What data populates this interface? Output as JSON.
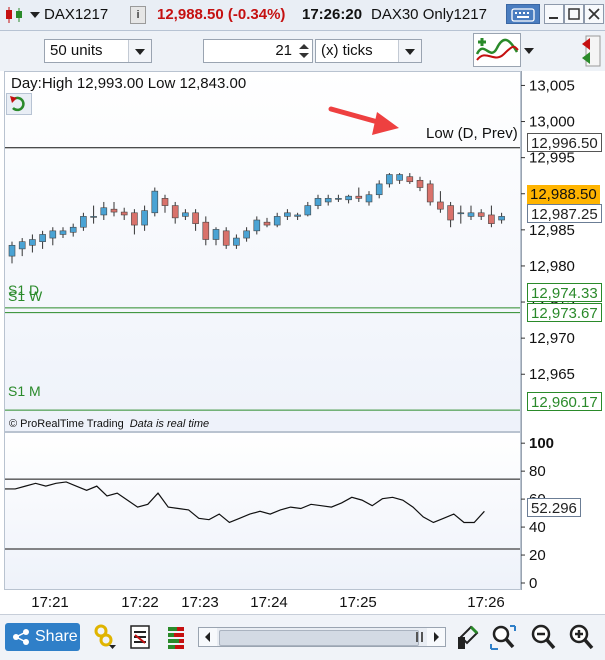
{
  "titlebar": {
    "symbol": "DAX1217",
    "price_change": "12,988.50 (-0.34%)",
    "time": "17:26:20",
    "instrument": "DAX30 Only1217",
    "info_icon_text": "i"
  },
  "toolbar": {
    "units_select": "50 units",
    "ticks_value": "21",
    "ticks_select": "(x) ticks"
  },
  "chart": {
    "header": "Day:High 12,993.00 Low 12,843.00",
    "watermark_source": "© ProRealTime Trading",
    "watermark_status": "Data is real time",
    "annotation": "Low (D, Prev)",
    "levels": [
      "S1 D",
      "S1 W",
      "S1 M"
    ]
  },
  "price_axis": {
    "ticks": [
      "13,005",
      "13,000",
      "12,995",
      "12,990",
      "12,985",
      "12,980",
      "12,975",
      "12,970",
      "12,965"
    ],
    "tags": [
      "12,996.50",
      "12,988.50",
      "12,987.25",
      "12,974.33",
      "12,973.67",
      "12,960.17"
    ]
  },
  "osc_axis": {
    "ticks": [
      "100",
      "80",
      "60",
      "40",
      "20",
      "0"
    ],
    "value_tag": "52.296"
  },
  "time_axis": [
    "17:21",
    "17:22",
    "17:23",
    "17:24",
    "17:25",
    "17:26"
  ],
  "bottombar": {
    "share_label": "Share"
  },
  "colors": {
    "price_down": "#c51010",
    "up_candle": "#4aa3d4",
    "down_candle": "#d9726b",
    "support_green": "#2a8a2a",
    "current_price_bg": "#ffb400",
    "accent": "#2f7fc8"
  },
  "chart_data": {
    "type": "candlestick",
    "ylabel": "",
    "xlabel": "",
    "ylim": [
      12957,
      13007
    ],
    "ohlc": [
      [
        12981.5,
        12983.5,
        12980.5,
        12983.0
      ],
      [
        12982.5,
        12984.0,
        12981.5,
        12983.5
      ],
      [
        12983.0,
        12984.5,
        12982.0,
        12983.8
      ],
      [
        12983.5,
        12985.0,
        12982.5,
        12984.5
      ],
      [
        12984.0,
        12985.5,
        12983.0,
        12985.0
      ],
      [
        12984.5,
        12985.5,
        12984.0,
        12985.0
      ],
      [
        12984.8,
        12986.0,
        12984.2,
        12985.5
      ],
      [
        12985.5,
        12987.5,
        12985.0,
        12987.0
      ],
      [
        12987.0,
        12988.5,
        12986.0,
        12987.0
      ],
      [
        12987.2,
        12989.0,
        12986.5,
        12988.2
      ],
      [
        12988.0,
        12989.0,
        12987.0,
        12987.6
      ],
      [
        12987.6,
        12988.2,
        12986.5,
        12987.2
      ],
      [
        12987.5,
        12988.0,
        12984.5,
        12985.8
      ],
      [
        12985.8,
        12988.5,
        12985.0,
        12987.8
      ],
      [
        12987.5,
        12991.0,
        12987.0,
        12990.5
      ],
      [
        12989.5,
        12990.0,
        12987.5,
        12988.5
      ],
      [
        12988.5,
        12989.0,
        12986.0,
        12986.8
      ],
      [
        12987.0,
        12988.0,
        12986.5,
        12987.5
      ],
      [
        12987.5,
        12988.0,
        12985.0,
        12986.0
      ],
      [
        12986.2,
        12987.0,
        12983.0,
        12983.8
      ],
      [
        12983.8,
        12985.5,
        12983.0,
        12985.2
      ],
      [
        12985.0,
        12985.5,
        12982.5,
        12983.0
      ],
      [
        12983.0,
        12984.5,
        12982.5,
        12984.0
      ],
      [
        12984.0,
        12985.5,
        12983.5,
        12985.0
      ],
      [
        12985.0,
        12987.0,
        12984.5,
        12986.5
      ],
      [
        12986.2,
        12986.8,
        12985.5,
        12985.8
      ],
      [
        12985.8,
        12987.5,
        12985.5,
        12987.0
      ],
      [
        12987.0,
        12988.0,
        12986.5,
        12987.5
      ],
      [
        12987.0,
        12987.5,
        12986.5,
        12987.2
      ],
      [
        12987.2,
        12989.0,
        12987.0,
        12988.5
      ],
      [
        12988.5,
        12990.0,
        12988.0,
        12989.5
      ],
      [
        12989.0,
        12990.0,
        12988.5,
        12989.5
      ],
      [
        12989.5,
        12990.0,
        12989.0,
        12989.5
      ],
      [
        12989.3,
        12990.0,
        12988.8,
        12989.8
      ],
      [
        12989.8,
        12991.0,
        12989.0,
        12989.5
      ],
      [
        12989.0,
        12990.5,
        12988.5,
        12990.0
      ],
      [
        12990.0,
        12992.0,
        12989.5,
        12991.5
      ],
      [
        12991.5,
        12993.0,
        12991.0,
        12992.8
      ],
      [
        12992.0,
        12993.0,
        12991.5,
        12992.8
      ],
      [
        12992.5,
        12993.0,
        12991.5,
        12991.8
      ],
      [
        12992.0,
        12992.5,
        12990.5,
        12991.0
      ],
      [
        12991.5,
        12992.0,
        12988.5,
        12989.0
      ],
      [
        12989.0,
        12990.5,
        12987.5,
        12988.0
      ],
      [
        12988.5,
        12989.0,
        12985.5,
        12986.5
      ],
      [
        12987.5,
        12988.5,
        12986.0,
        12987.5
      ],
      [
        12987.0,
        12988.5,
        12986.5,
        12987.5
      ],
      [
        12987.5,
        12988.0,
        12986.5,
        12987.0
      ],
      [
        12987.2,
        12988.5,
        12985.5,
        12986.0
      ],
      [
        12986.5,
        12987.5,
        12986.0,
        12987.0
      ]
    ],
    "support_levels": [
      {
        "name": "S1 D",
        "value": 12974.33
      },
      {
        "name": "S1 W",
        "value": 12973.67
      },
      {
        "name": "S1 M",
        "value": 12960.17
      }
    ],
    "reference_levels": [
      {
        "name": "Low (D, Prev)",
        "value": 12996.5
      }
    ],
    "current_price": 12988.5,
    "oscillator": {
      "ylim": [
        -5,
        108
      ],
      "hlines": [
        75,
        25
      ],
      "values": [
        68,
        68,
        70,
        72,
        70,
        72,
        73,
        70,
        67,
        70,
        63,
        65,
        60,
        55,
        57,
        65,
        55,
        54,
        53,
        47,
        46,
        50,
        44,
        47,
        50,
        52,
        50,
        53,
        55,
        54,
        57,
        56,
        55,
        58,
        62,
        60,
        56,
        61,
        62,
        60,
        55,
        48,
        44,
        47,
        50,
        44,
        44,
        52
      ]
    }
  }
}
